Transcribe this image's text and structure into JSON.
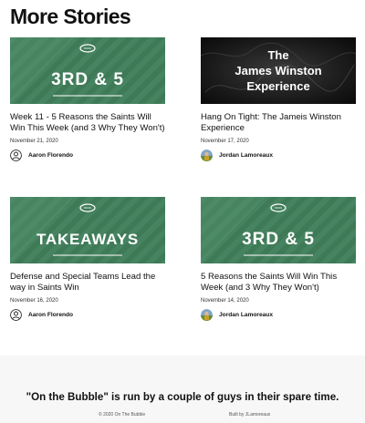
{
  "section": {
    "title": "More Stories"
  },
  "stories": [
    {
      "image_text": "3RD & 5",
      "title": "Week 11 - 5 Reasons the Saints Will Win This Week (and 3 Why They Won't)",
      "date": "November 21, 2020",
      "author": "Aaron Florendo"
    },
    {
      "image_text": [
        "The",
        "James Winston",
        "Experience"
      ],
      "title": "Hang On Tight: The Jameis Winston Experience",
      "date": "November 17, 2020",
      "author": "Jordan Lamoreaux"
    },
    {
      "image_text": "TAKEAWAYS",
      "title": "Defense and Special Teams Lead the way in Saints Win",
      "date": "November 16, 2020",
      "author": "Aaron Florendo"
    },
    {
      "image_text": "3RD & 5",
      "title": "5 Reasons the Saints Will Win This Week (and 3 Why They Won't)",
      "date": "November 14, 2020",
      "author": "Jordan Lamoreaux"
    }
  ],
  "footer": {
    "tagline": "\"On the Bubble\" is run by a couple of guys in their spare time.",
    "copyright": "© 2020 On The Bubble",
    "built_by": "Built by JLamoreaux"
  },
  "colors": {
    "field_green": "#3f7a57",
    "field_green_dark": "#2f6546",
    "field_light": "#5f9a75"
  }
}
